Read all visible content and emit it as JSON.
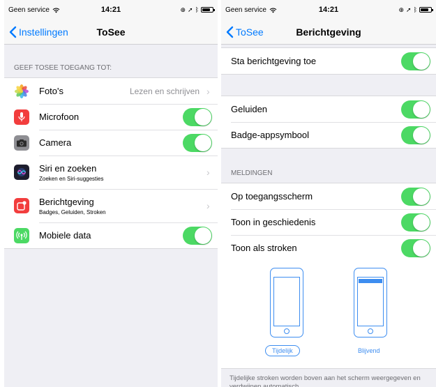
{
  "left": {
    "status": {
      "carrier": "Geen service",
      "time": "14:21"
    },
    "nav": {
      "back": "Instellingen",
      "title": "ToSee"
    },
    "section_header": "GEEF TOSEE TOEGANG TOT:",
    "rows": {
      "photos": {
        "label": "Foto's",
        "value": "Lezen en schrijven",
        "icon": "photos-icon"
      },
      "microphone": {
        "label": "Microfoon",
        "toggle": true,
        "icon": "microphone-icon"
      },
      "camera": {
        "label": "Camera",
        "toggle": true,
        "icon": "camera-icon"
      },
      "siri": {
        "label": "Siri en zoeken",
        "sub": "Zoeken en Siri-suggesties",
        "icon": "siri-icon"
      },
      "notifications": {
        "label": "Berichtgeving",
        "sub": "Badges, Geluiden, Stroken",
        "icon": "notifications-icon"
      },
      "mobile_data": {
        "label": "Mobiele data",
        "toggle": true,
        "icon": "antenna-icon"
      }
    }
  },
  "right": {
    "status": {
      "carrier": "Geen service",
      "time": "14:21"
    },
    "nav": {
      "back": "ToSee",
      "title": "Berichtgeving"
    },
    "allow": {
      "label": "Sta berichtgeving toe",
      "toggle": true
    },
    "sounds": {
      "label": "Geluiden",
      "toggle": true
    },
    "badge": {
      "label": "Badge-appsymbool",
      "toggle": true
    },
    "section_header": "MELDINGEN",
    "lock_screen": {
      "label": "Op toegangsscherm",
      "toggle": true
    },
    "history": {
      "label": "Toon in geschiedenis",
      "toggle": true
    },
    "banners": {
      "label": "Toon als stroken",
      "toggle": true
    },
    "banner_styles": {
      "temporary": "Tijdelijk",
      "persistent": "Blijvend",
      "selected": "Tijdelijk"
    },
    "footer": "Tijdelijke stroken worden boven aan het scherm weergegeven en verdwijnen automatisch."
  },
  "colors": {
    "accent": "#007aff",
    "toggle_on": "#4cd964",
    "background": "#efeff4"
  }
}
